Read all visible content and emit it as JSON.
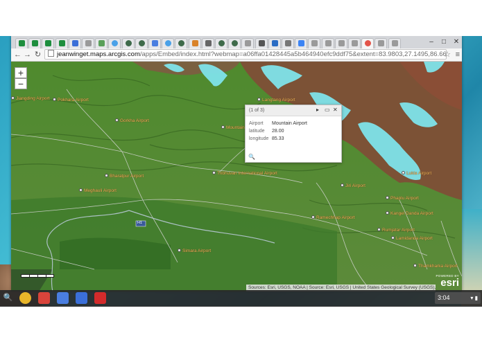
{
  "browser": {
    "tabs": [
      {
        "icon": "sheets-icon",
        "color": "#1e8e3e"
      },
      {
        "icon": "sheets-icon",
        "color": "#1e8e3e"
      },
      {
        "icon": "sheets-icon",
        "color": "#1e8e3e"
      },
      {
        "icon": "sheets-icon",
        "color": "#1e8e3e"
      },
      {
        "icon": "docs-icon",
        "color": "#3b6fd8"
      },
      {
        "icon": "page-icon",
        "color": "#9a9a9a"
      },
      {
        "icon": "tool-icon",
        "color": "#5aa05a"
      },
      {
        "icon": "twitter-icon",
        "color": "#4aa1e8"
      },
      {
        "icon": "globe-icon",
        "color": "#3e6a4a"
      },
      {
        "icon": "globe-icon",
        "color": "#3e6a4a"
      },
      {
        "icon": "google-icon",
        "color": "#4a7ee0"
      },
      {
        "icon": "twitter-icon",
        "color": "#4aa1e8"
      },
      {
        "icon": "globe-icon",
        "color": "#3e6a4a"
      },
      {
        "icon": "puzzle-icon",
        "color": "#d9832a"
      },
      {
        "icon": "fw-icon",
        "color": "#666666"
      },
      {
        "icon": "globe-icon",
        "color": "#3e6a4a"
      },
      {
        "icon": "globe-icon",
        "color": "#3e6a4a"
      },
      {
        "icon": "page-icon",
        "color": "#9a9a9a"
      },
      {
        "icon": "back-arrow-icon",
        "color": "#555555"
      },
      {
        "icon": "outlook-icon",
        "color": "#2a6cc4"
      },
      {
        "icon": "email-icon",
        "color": "#777777"
      },
      {
        "icon": "google-g-icon",
        "color": "#3c84f4"
      },
      {
        "icon": "page-icon",
        "color": "#9a9a9a"
      },
      {
        "icon": "page-icon",
        "color": "#9a9a9a"
      },
      {
        "icon": "page-icon",
        "color": "#9a9a9a"
      },
      {
        "icon": "page-icon",
        "color": "#9a9a9a"
      },
      {
        "icon": "arcgis-icon",
        "color": "#e3554a",
        "active": true
      },
      {
        "icon": "page-icon",
        "color": "#9a9a9a"
      },
      {
        "icon": "page-icon",
        "color": "#9a9a9a"
      }
    ],
    "url_host": "jeanwinget.maps.arcgis.com",
    "url_path": "/apps/Embed/index.html?webmap=a06ffa01428445a5b464940efc9ddf75&extent=83.9803,27.1495,86.6609,28.2511&zoom=true"
  },
  "map": {
    "zoom_in": "+",
    "zoom_out": "−",
    "places": [
      {
        "id": "jiang",
        "name": "Jiangding Airport"
      },
      {
        "id": "pokhara",
        "name": "Pokhara Airport"
      },
      {
        "id": "gorkha",
        "name": "Gorkha Airport"
      },
      {
        "id": "langtang",
        "name": "Langtang Airport"
      },
      {
        "id": "mountain",
        "name": "Mountain Airport"
      },
      {
        "id": "tribhuvan",
        "name": "Tribhuvan International Airport"
      },
      {
        "id": "bharatpur",
        "name": "Bharatpur Airport"
      },
      {
        "id": "meghauli",
        "name": "Meghauli Airport"
      },
      {
        "id": "jiri",
        "name": "Jiri Airport"
      },
      {
        "id": "lukla",
        "name": "Lukla Airport"
      },
      {
        "id": "phaplu",
        "name": "Phaplu Airport"
      },
      {
        "id": "kangel",
        "name": "Kangel Danda Airport"
      },
      {
        "id": "ramechhap",
        "name": "Ramechhap Airport"
      },
      {
        "id": "rumjatar",
        "name": "Rumjatar Airport"
      },
      {
        "id": "lamidanda",
        "name": "Lamidanda Airport"
      },
      {
        "id": "simara",
        "name": "Simara Airport"
      },
      {
        "id": "thamkharka",
        "name": "Thamkharka Airport"
      }
    ],
    "road_label": "H1",
    "popup": {
      "count": "(1 of 3)",
      "rows": [
        {
          "key": "Airport",
          "value": "Mountain Airport"
        },
        {
          "key": "latitude",
          "value": "28.00"
        },
        {
          "key": "longitude",
          "value": "85.33"
        }
      ]
    },
    "attribution": "Sources: Esri, USGS, NOAA | Source: Esri, USGS | United States Geological Survey (USGS), Nati...",
    "esri_powered": "POWERED BY",
    "esri_logo": "esri"
  },
  "shelf": {
    "apps": [
      {
        "icon": "chrome-icon",
        "color": "#e8b52a"
      },
      {
        "icon": "gmail-icon",
        "color": "#d9443b"
      },
      {
        "icon": "google-search-icon",
        "color": "#4a7ee0"
      },
      {
        "icon": "docs-icon",
        "color": "#3b6fd8"
      },
      {
        "icon": "youtube-icon",
        "color": "#d32b2b"
      }
    ],
    "time": "3:04"
  }
}
